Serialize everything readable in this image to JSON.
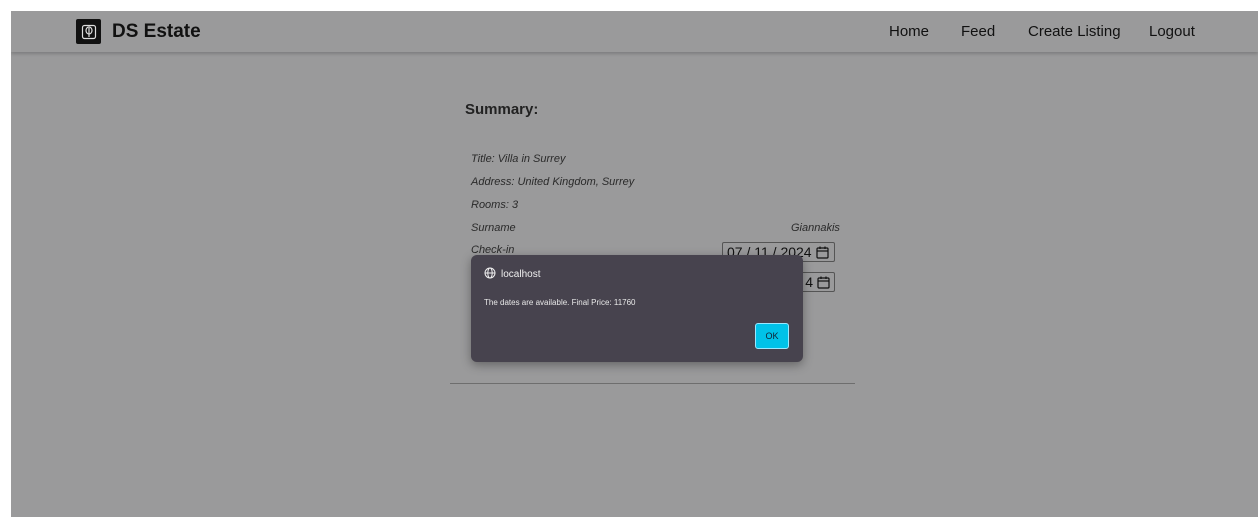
{
  "navbar": {
    "brand": "DS Estate",
    "links": [
      "Home",
      "Feed",
      "Create Listing",
      "Logout"
    ]
  },
  "summary": {
    "heading": "Summary:",
    "title_line": "Title: Villa in Surrey",
    "address_line": "Address: United Kingdom, Surrey",
    "rooms_line": "Rooms: 3",
    "surname_label": "Surname",
    "surname_value": "Giannakis",
    "checkin_label": "Check-in",
    "checkin_value": "07 / 11 / 2024",
    "checkout_value_visible": "4"
  },
  "dialog": {
    "origin": "localhost",
    "message": "The dates are available. Final Price: 11760",
    "ok_label": "OK"
  },
  "colors": {
    "backdrop": "#9a9a9b",
    "dialog_bg": "#47434e",
    "ok_button": "#00c2e8"
  },
  "icons": [
    "logo-icon",
    "calendar-icon",
    "globe-icon"
  ]
}
